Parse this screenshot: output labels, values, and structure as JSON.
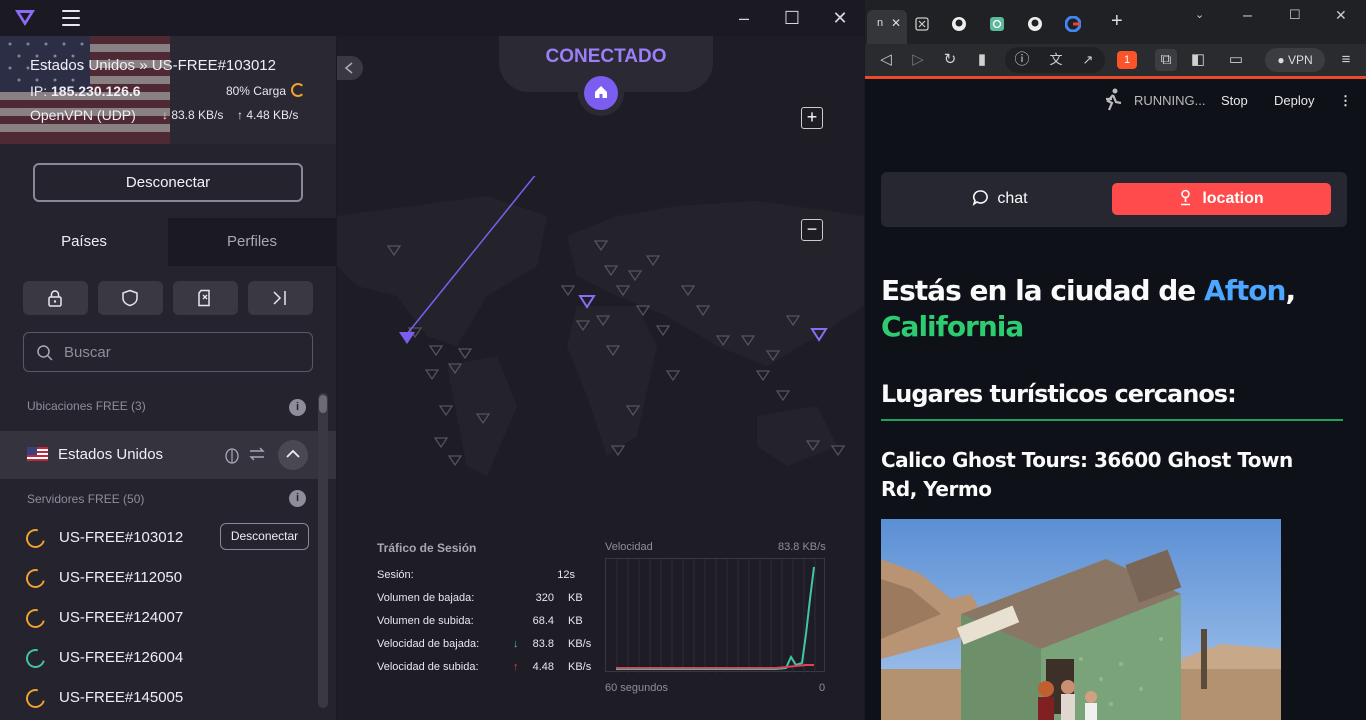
{
  "vpn": {
    "status": "CONECTADO",
    "connection": {
      "route": "Estados Unidos » US-FREE#103012",
      "ip_label": "IP:",
      "ip": "185.230.126.6",
      "load": "80% Carga",
      "protocol": "OpenVPN (UDP)",
      "down": "83.8 KB/s",
      "up": "4.48 KB/s"
    },
    "disconnect_label": "Desconectar",
    "tabs": [
      "Países",
      "Perfiles"
    ],
    "search_placeholder": "Buscar",
    "free_locations": "Ubicaciones FREE (3)",
    "country": "Estados Unidos",
    "free_servers": "Servidores FREE (50)",
    "servers": [
      {
        "name": "US-FREE#103012",
        "status": "orange",
        "action": "Desconectar"
      },
      {
        "name": "US-FREE#112050",
        "status": "orange"
      },
      {
        "name": "US-FREE#124007",
        "status": "orange"
      },
      {
        "name": "US-FREE#126004",
        "status": "green"
      },
      {
        "name": "US-FREE#145005",
        "status": "orange"
      }
    ],
    "session": {
      "title": "Tráfico de Sesión",
      "rows": [
        {
          "label": "Sesión:",
          "value": "12s",
          "unit": ""
        },
        {
          "label": "Volumen de bajada:",
          "value": "320",
          "unit": "KB"
        },
        {
          "label": "Volumen de subida:",
          "value": "68.4",
          "unit": "KB"
        },
        {
          "label": "Velocidad de bajada:",
          "value": "83.8",
          "unit": "KB/s"
        },
        {
          "label": "Velocidad de subida:",
          "value": "4.48",
          "unit": "KB/s"
        }
      ],
      "graph_title": "Velocidad",
      "graph_max": "83.8  KB/s",
      "graph_xleft": "60 segundos",
      "graph_xright": "0"
    },
    "colors": {
      "accent": "#7b5ef0",
      "load": "#f2a030",
      "ok": "#3fc7a3",
      "down": "#3fc7a3",
      "up": "#e0405a"
    }
  },
  "browser": {
    "tabs": [
      "n",
      "",
      "",
      "",
      "",
      ""
    ],
    "vpn_label": "VPN",
    "ext_badge": "1",
    "status": {
      "running": "RUNNING...",
      "stop": "Stop",
      "deploy": "Deploy"
    },
    "chat_label": "chat",
    "location_label": "location",
    "heading_prefix": "Estás en la ciudad de ",
    "city": "Afton",
    "comma": ",",
    "state": "California",
    "nearby": "Lugares turísticos cercanos:",
    "place": "Calico Ghost Tours: 36600 Ghost Town Rd, Yermo",
    "colors": {
      "city": "#4da6ff",
      "state": "#2ecc71",
      "button": "#ff4b4b"
    }
  }
}
